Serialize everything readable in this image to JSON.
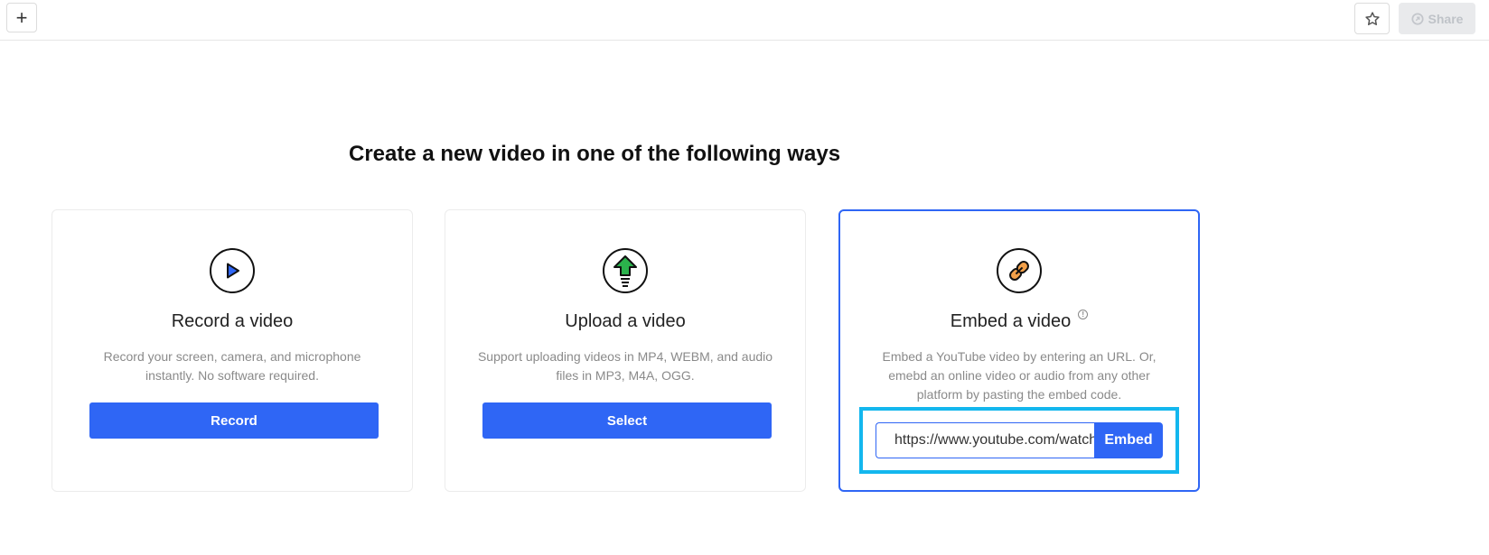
{
  "topbar": {
    "add_label": "+",
    "star_icon": "star-icon",
    "share_label": "Share",
    "share_icon": "share-icon"
  },
  "heading": "Create a new video in one of the following ways",
  "cards": {
    "record": {
      "icon": "play-icon",
      "title": "Record a video",
      "description": "Record your screen, camera, and microphone instantly. No software required.",
      "button_label": "Record"
    },
    "upload": {
      "icon": "upload-arrow-icon",
      "title": "Upload a video",
      "description": "Support uploading videos in MP4, WEBM, and audio files in MP3, M4A, OGG.",
      "button_label": "Select"
    },
    "embed": {
      "icon": "link-icon",
      "title": "Embed a video",
      "info_icon": "info-icon",
      "description": "Embed a YouTube video by entering an URL. Or, emebd an online video or audio from any other platform by pasting the embed code.",
      "input_value": "https://www.youtube.com/watch",
      "button_label": "Embed"
    }
  },
  "colors": {
    "primary": "#2f66f5",
    "highlight": "#13b7ee",
    "upload_arrow": "#2bb24c",
    "link_icon": "#f2a04a"
  }
}
